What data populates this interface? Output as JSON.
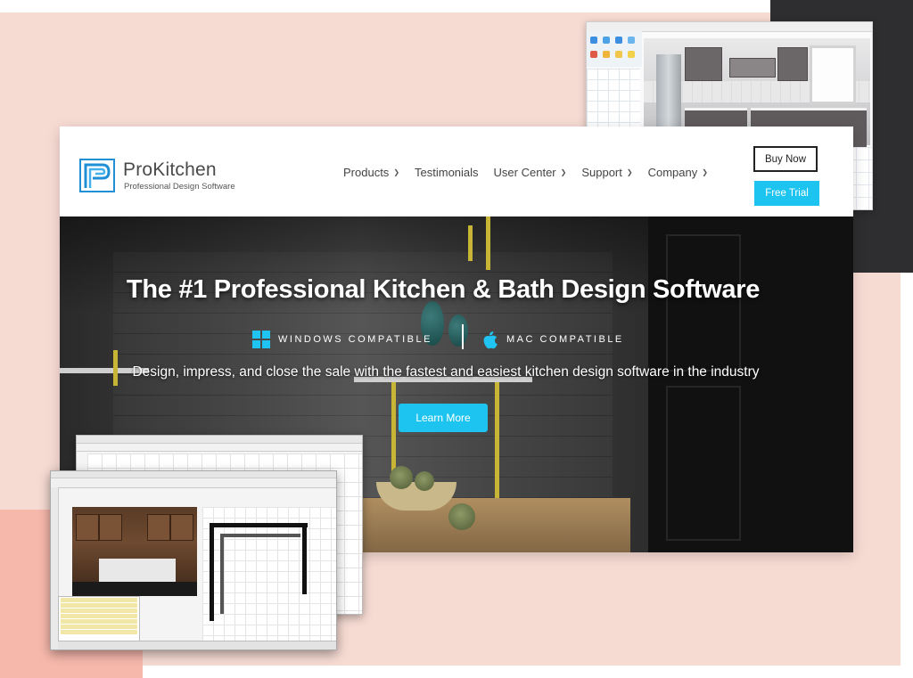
{
  "colors": {
    "accent": "#1ec4f0",
    "background_peach": "#f6dbd3",
    "background_dark": "#2e2e30",
    "background_coral": "#f7b8ac",
    "logo_blue": "#1f8fd6",
    "text_dark": "#444444"
  },
  "header": {
    "brand_name": "ProKitchen",
    "brand_tagline": "Professional Design Software",
    "logo_icon": "prokitchen-logo-icon",
    "nav": [
      {
        "label": "Products",
        "has_dropdown": true
      },
      {
        "label": "Testimonials",
        "has_dropdown": false
      },
      {
        "label": "User Center",
        "has_dropdown": true
      },
      {
        "label": "Support",
        "has_dropdown": true
      },
      {
        "label": "Company",
        "has_dropdown": true
      }
    ],
    "buy_now_label": "Buy Now",
    "free_trial_label": "Free Trial"
  },
  "hero": {
    "title": "The #1 Professional Kitchen & Bath Design Software",
    "windows_label": "WINDOWS COMPATIBLE",
    "mac_label": "MAC COMPATIBLE",
    "windows_icon": "windows-icon",
    "mac_icon": "apple-icon",
    "subtitle": "Design, impress, and close the sale with the fastest and easiest kitchen design software in the industry",
    "learn_more_label": "Learn More"
  }
}
